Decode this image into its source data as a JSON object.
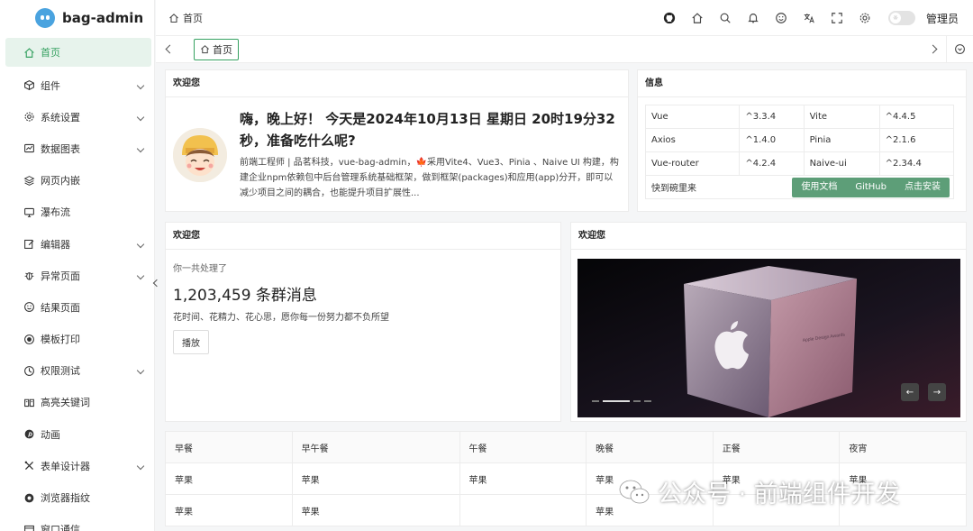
{
  "app": {
    "logo_text": "bag-admin"
  },
  "sidebar": {
    "items": [
      {
        "label": "首页",
        "icon": "home-icon",
        "active": true,
        "expandable": false
      },
      {
        "label": "组件",
        "icon": "cube-icon",
        "expandable": true
      },
      {
        "label": "系统设置",
        "icon": "gear-icon",
        "expandable": true
      },
      {
        "label": "数据图表",
        "icon": "chart-icon",
        "expandable": true
      },
      {
        "label": "网页内嵌",
        "icon": "layers-icon",
        "expandable": false
      },
      {
        "label": "瀑布流",
        "icon": "monitor-icon",
        "expandable": false
      },
      {
        "label": "编辑器",
        "icon": "edit-icon",
        "expandable": true
      },
      {
        "label": "异常页面",
        "icon": "bug-icon",
        "expandable": true
      },
      {
        "label": "结果页面",
        "icon": "smile-icon",
        "expandable": false
      },
      {
        "label": "模板打印",
        "icon": "record-icon",
        "expandable": false
      },
      {
        "label": "权限测试",
        "icon": "lock-icon",
        "expandable": true
      },
      {
        "label": "高亮关键词",
        "icon": "book-icon",
        "expandable": false
      },
      {
        "label": "动画",
        "icon": "pinterest-icon",
        "expandable": false
      },
      {
        "label": "表单设计器",
        "icon": "tools-icon",
        "expandable": true
      },
      {
        "label": "浏览器指纹",
        "icon": "chrome-icon",
        "expandable": false
      },
      {
        "label": "窗口通信",
        "icon": "window-icon",
        "expandable": false
      }
    ]
  },
  "header": {
    "breadcrumb": "首页",
    "admin_label": "管理员",
    "icons": [
      "github-icon",
      "home-icon",
      "search-icon",
      "bell-icon",
      "smile-icon",
      "translate-icon",
      "fullscreen-icon",
      "gear-icon"
    ]
  },
  "tabs": {
    "active_label": "首页"
  },
  "welcome_card": {
    "title": "欢迎您",
    "greeting": "嗨，晚上好！ 今天是2024年10月13日 星期日 20时19分32秒，准备吃什么呢?",
    "description": "前端工程师 | 品茗科技，vue-bag-admin，🍁采用Vite4、Vue3、Pinia 、Naive UI 构建，构建企业npm依赖包中后台管理系统基础框架，做到框架(packages)和应用(app)分开，即可以减少项目之间的耦合，也能提升项目扩展性..."
  },
  "info_card": {
    "title": "信息",
    "rows": [
      [
        "Vue",
        "^3.3.4",
        "Vite",
        "^4.4.5"
      ],
      [
        "Axios",
        "^1.4.0",
        "Pinia",
        "^2.1.6"
      ],
      [
        "Vue-router",
        "^4.2.4",
        "Naive-ui",
        "^2.34.4"
      ]
    ],
    "footer_label": "快到碗里来",
    "buttons": [
      "使用文档",
      "GitHub",
      "点击安装"
    ],
    "button_color": "#5d9e78"
  },
  "stats_card": {
    "title": "欢迎您",
    "subtitle": "你一共处理了",
    "count": "1,203,459 条群消息",
    "line": "花时间、花精力、花心思，愿你每一份努力都不负所望",
    "button": "播放"
  },
  "carousel_card": {
    "title": "欢迎您",
    "active_slide": 2,
    "slide_count": 4
  },
  "meals_table": {
    "headers": [
      "早餐",
      "早午餐",
      "午餐",
      "晚餐",
      "正餐",
      "夜宵"
    ],
    "rows": [
      [
        "苹果",
        "苹果",
        "苹果",
        "苹果",
        "苹果",
        "苹果"
      ],
      [
        "苹果",
        "苹果",
        "",
        "苹果",
        "",
        ""
      ]
    ]
  },
  "watermark": {
    "text": "公众号 · 前端组件开发"
  },
  "colors": {
    "accent": "#36a161",
    "active_bg": "#e7f3ec"
  }
}
